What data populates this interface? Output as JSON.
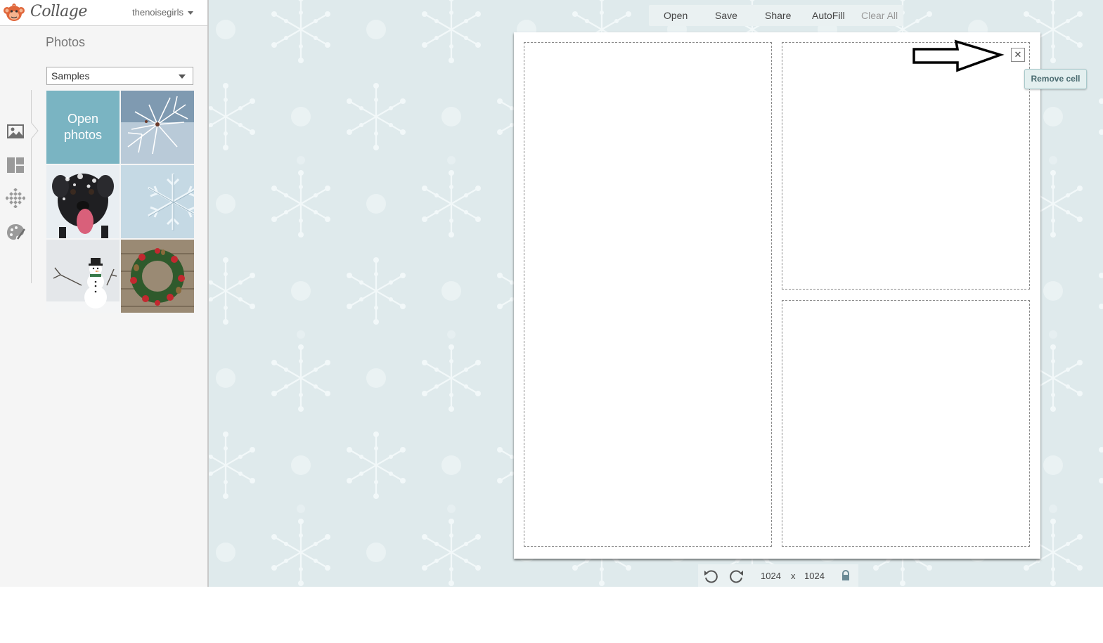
{
  "app": {
    "name": "Collage",
    "username": "thenoisegirls"
  },
  "sidebar": {
    "panel_title": "Photos",
    "source_select": {
      "value": "Samples"
    },
    "tools": [
      {
        "name": "photos-tool",
        "icon": "image-icon"
      },
      {
        "name": "layout-tool",
        "icon": "layout-icon"
      },
      {
        "name": "background-tool",
        "icon": "pattern-icon"
      },
      {
        "name": "style-tool",
        "icon": "palette-icon"
      }
    ],
    "open_tile_label_line1": "Open",
    "open_tile_label_line2": "photos",
    "thumbnails": [
      {
        "subject": "frosted-pine-branch"
      },
      {
        "subject": "dog-in-snow"
      },
      {
        "subject": "snowflake-in-snow"
      },
      {
        "subject": "snowman"
      },
      {
        "subject": "christmas-wreath"
      }
    ]
  },
  "toolbar": {
    "open": "Open",
    "save": "Save",
    "share": "Share",
    "autofill": "AutoFill",
    "clear_all": "Clear All"
  },
  "canvas": {
    "cells": 3,
    "remove_symbol": "✕",
    "tooltip": "Remove cell"
  },
  "bottom_bar": {
    "width": "1024",
    "times": "x",
    "height": "1024"
  },
  "colors": {
    "accent_tile": "#7ab4c2",
    "workspace_bg": "#dfeaec",
    "logo_orange": "#e0663a"
  }
}
